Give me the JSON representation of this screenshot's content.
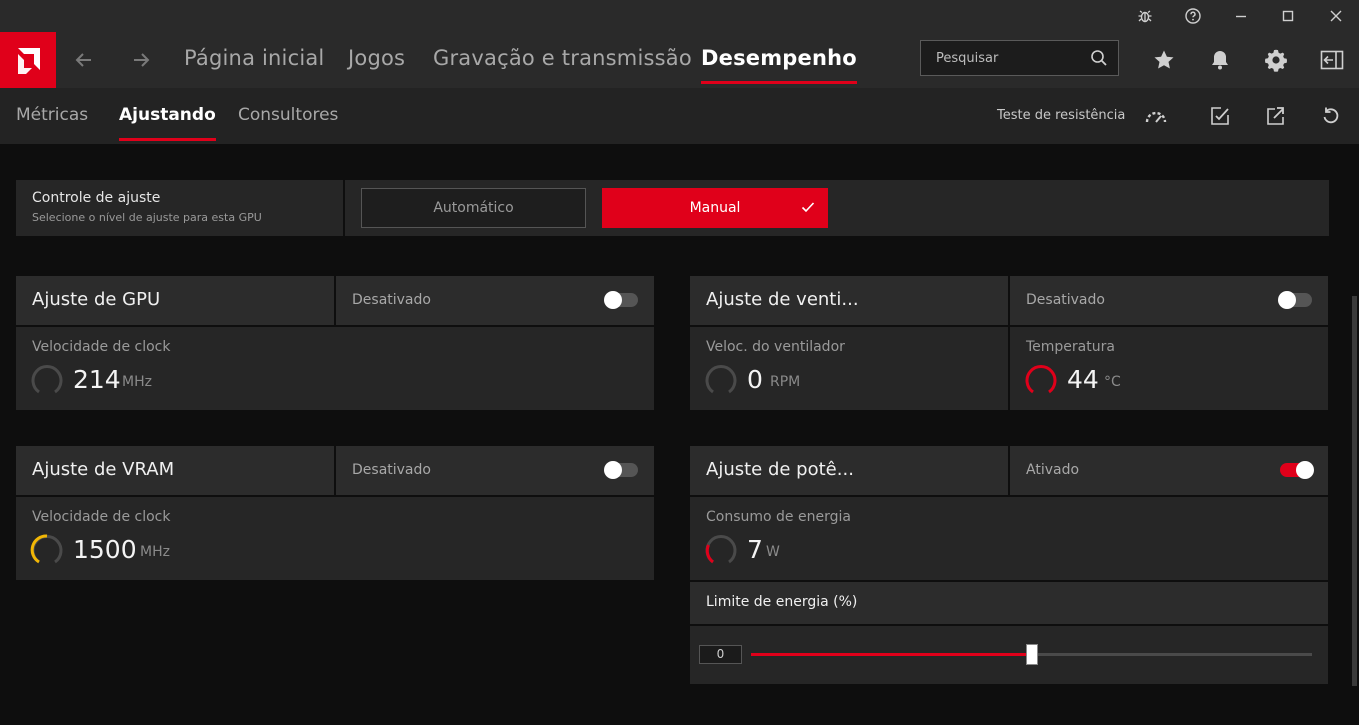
{
  "titlebar": {
    "icons": [
      "bug-icon",
      "help-icon",
      "minimize-icon",
      "maximize-icon",
      "close-icon"
    ]
  },
  "topnav": {
    "tabs": [
      {
        "label": "Página inicial"
      },
      {
        "label": "Jogos"
      },
      {
        "label": "Gravação e transmissão"
      },
      {
        "label": "Desempenho"
      }
    ],
    "active_tab": "Desempenho",
    "search_placeholder": "Pesquisar"
  },
  "subnav": {
    "tabs": [
      {
        "label": "Métricas"
      },
      {
        "label": "Ajustando"
      },
      {
        "label": "Consultores"
      }
    ],
    "active_tab": "Ajustando",
    "stress_test_label": "Teste de resistência"
  },
  "tuning_control": {
    "title": "Controle de ajuste",
    "subtitle": "Selecione o nível de ajuste para esta GPU",
    "auto_label": "Automático",
    "manual_label": "Manual",
    "selected": "Manual"
  },
  "gpu_tuning": {
    "title": "Ajuste de GPU",
    "state": "Desativado",
    "enabled": false,
    "metric_label": "Velocidade de clock",
    "value": "214",
    "unit": "MHz"
  },
  "fan_tuning": {
    "title": "Ajuste de venti...",
    "state": "Desativado",
    "enabled": false,
    "fan_label": "Veloc. do ventilador",
    "fan_value": "0",
    "fan_unit": "RPM",
    "temp_label": "Temperatura",
    "temp_value": "44",
    "temp_unit": "°C"
  },
  "vram_tuning": {
    "title": "Ajuste de VRAM",
    "state": "Desativado",
    "enabled": false,
    "metric_label": "Velocidade de clock",
    "value": "1500",
    "unit": "MHz"
  },
  "power_tuning": {
    "title": "Ajuste de potê...",
    "state": "Ativado",
    "enabled": true,
    "metric_label": "Consumo de energia",
    "value": "7",
    "unit": "W",
    "limit_label": "Limite de energia (%)",
    "limit_value": "0",
    "slider_fraction": 0.5
  },
  "colors": {
    "accent": "#e0001a",
    "vram_gauge": "#f2b705",
    "background": "#0e0e0e",
    "panel": "#262626"
  }
}
